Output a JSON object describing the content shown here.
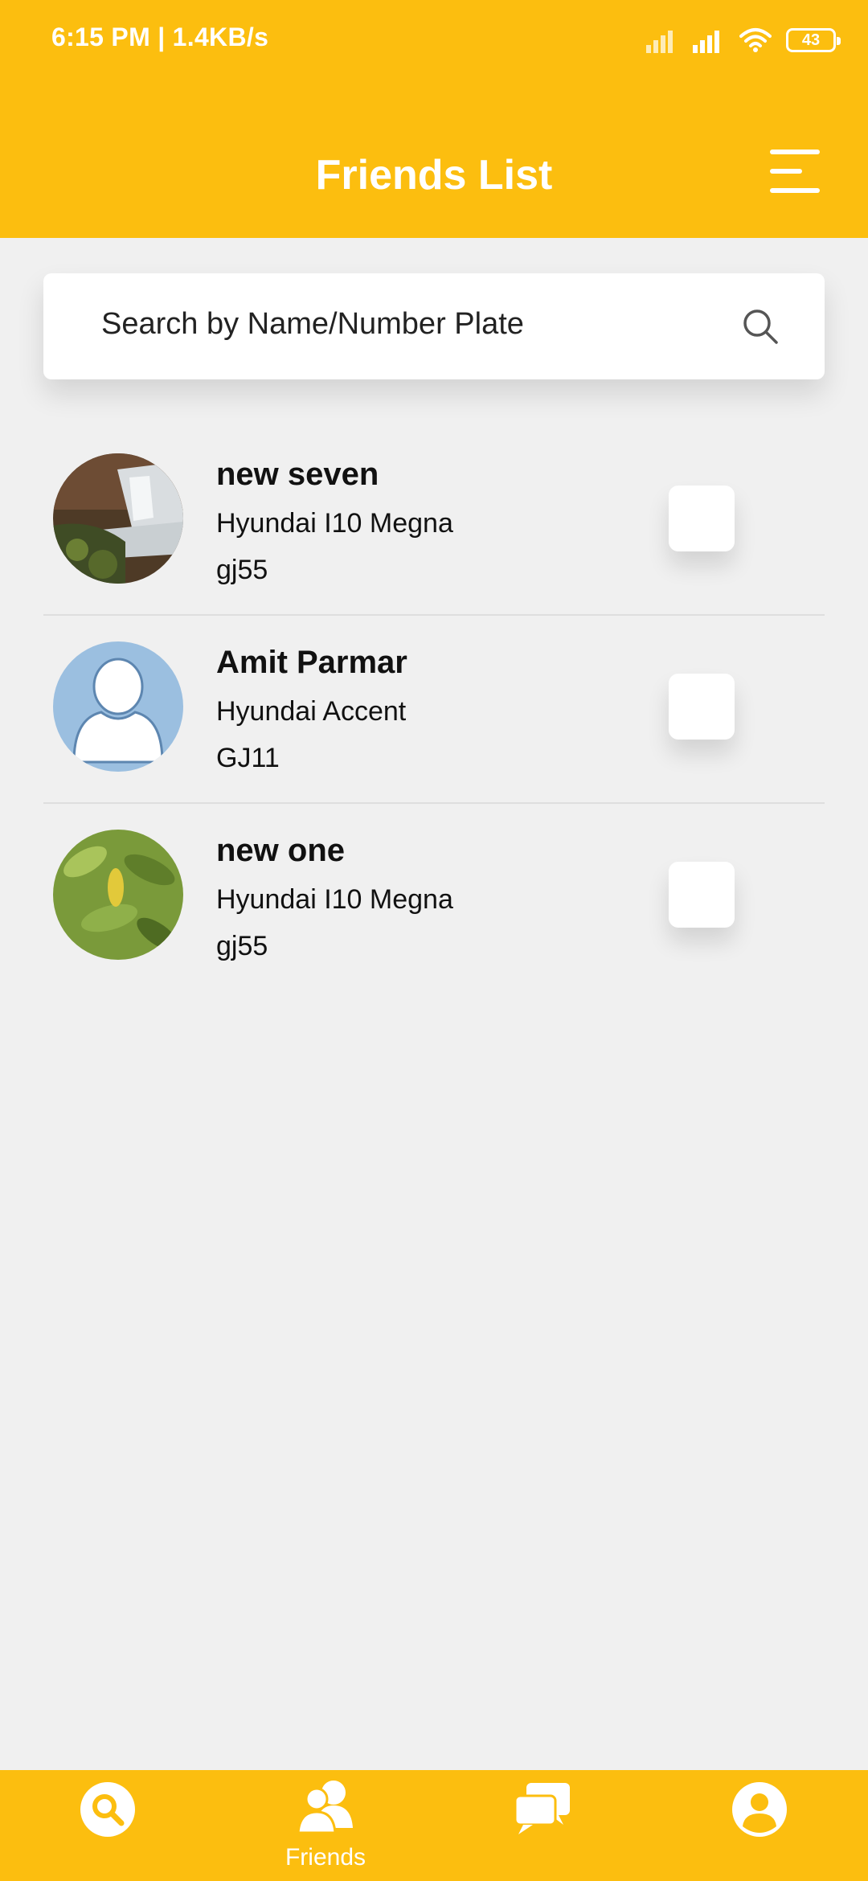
{
  "status_bar": {
    "time_speed": "6:15 PM | 1.4KB/s",
    "battery": "43",
    "icons": [
      "signal-icon",
      "signal-icon",
      "wifi-icon",
      "battery-icon"
    ]
  },
  "header": {
    "title": "Friends List",
    "menu_icon": "hamburger-menu-icon"
  },
  "search": {
    "placeholder": "Search by Name/Number Plate",
    "icon": "search-icon"
  },
  "friends": [
    {
      "name": "new seven",
      "car": "Hyundai I10 Megna",
      "plate": "gj55",
      "avatar": "landscape-photo",
      "checked": false
    },
    {
      "name": "Amit Parmar",
      "car": "Hyundai Accent",
      "plate": "GJ11",
      "avatar": "default-user",
      "checked": false
    },
    {
      "name": "new one",
      "car": "Hyundai I10 Megna",
      "plate": "gj55",
      "avatar": "leaf-photo",
      "checked": false
    }
  ],
  "bottom_nav": {
    "items": [
      {
        "icon": "search-icon",
        "label": ""
      },
      {
        "icon": "friends-icon",
        "label": "Friends",
        "active": true
      },
      {
        "icon": "chat-icon",
        "label": ""
      },
      {
        "icon": "profile-icon",
        "label": ""
      }
    ]
  },
  "colors": {
    "accent": "#fcbe0f",
    "background": "#f0f0f0",
    "avatar_default": "#9bbfe0"
  }
}
